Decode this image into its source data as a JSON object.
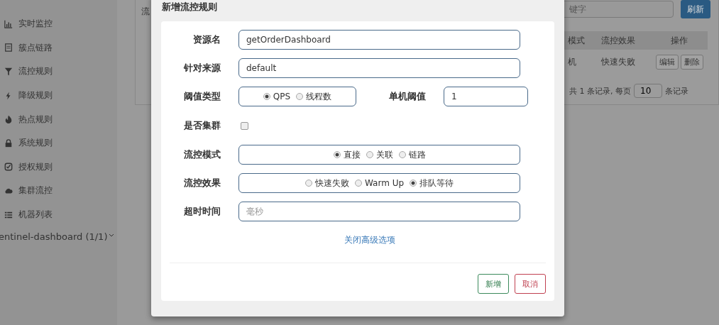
{
  "sidebar": {
    "items": [
      {
        "label": "实时监控"
      },
      {
        "label": "簇点链路"
      },
      {
        "label": "流控规则"
      },
      {
        "label": "降级规则"
      },
      {
        "label": "热点规则"
      },
      {
        "label": "系统规则"
      },
      {
        "label": "授权规则"
      },
      {
        "label": "集群流控"
      },
      {
        "label": "机器列表"
      }
    ],
    "app": {
      "label": "entinel-dashboard (1/1)"
    }
  },
  "panel": {
    "title": "流",
    "search": {
      "placeholder": "键字"
    },
    "refresh_button": "刷新",
    "table": {
      "columns": [
        "模式",
        "流控效果",
        "操作"
      ],
      "rows": [
        {
          "cells": [
            "机",
            "快速失败"
          ],
          "actions": [
            "编辑",
            "删除"
          ]
        }
      ]
    },
    "pagination": {
      "prefix": "共 1 条记录, 每页",
      "page_size": "10",
      "suffix": "条记录"
    }
  },
  "modal": {
    "title": "新增流控规则",
    "fields": [
      {
        "kind": "text",
        "label": "资源名",
        "value": "getOrderDashboard"
      },
      {
        "kind": "text",
        "label": "针对来源",
        "value": "default"
      },
      {
        "kind": "radio_value",
        "label": "阈值类型",
        "options": [
          {
            "label": "QPS",
            "selected": true
          },
          {
            "label": "线程数",
            "selected": false
          }
        ],
        "value_label": "单机阈值",
        "value": "1"
      },
      {
        "kind": "checkbox",
        "label": "是否集群",
        "checked": false
      },
      {
        "kind": "radio",
        "label": "流控模式",
        "options": [
          {
            "label": "直接",
            "selected": true
          },
          {
            "label": "关联",
            "selected": false
          },
          {
            "label": "链路",
            "selected": false
          }
        ]
      },
      {
        "kind": "radio",
        "label": "流控效果",
        "options": [
          {
            "label": "快速失败",
            "selected": false
          },
          {
            "label": "Warm Up",
            "selected": false
          },
          {
            "label": "排队等待",
            "selected": true
          }
        ]
      },
      {
        "kind": "text",
        "label": "超时时间",
        "placeholder": "毫秒"
      }
    ],
    "advanced_link": "关闭高级选项",
    "buttons": [
      {
        "kind": "primary",
        "label": "新增"
      },
      {
        "kind": "cancel",
        "label": "取消"
      }
    ]
  }
}
